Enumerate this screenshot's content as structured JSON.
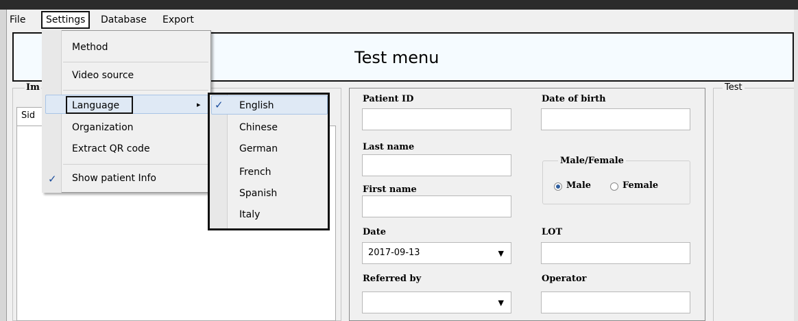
{
  "menubar": {
    "file": "File",
    "settings": "Settings",
    "database": "Database",
    "export": "Export"
  },
  "title": "Test menu",
  "left_group": {
    "title_fragment": "Im",
    "tab_fragment": "Sid"
  },
  "settings_menu": {
    "items": [
      "Method",
      "Video source",
      "Language",
      "Organization",
      "Extract QR code",
      "Show patient Info"
    ],
    "checked_item": "Show patient Info",
    "check_mark": "✓",
    "submenu_arrow": "▸"
  },
  "language_menu": {
    "items": [
      "English",
      "Chinese",
      "German",
      "French",
      "Spanish",
      "Italy"
    ],
    "selected": "English",
    "check_mark": "✓"
  },
  "form": {
    "patient_id": {
      "label": "Patient ID",
      "value": ""
    },
    "date_of_birth": {
      "label": "Date of birth",
      "value": ""
    },
    "last_name": {
      "label": "Last name",
      "value": ""
    },
    "first_name": {
      "label": "First name",
      "value": ""
    },
    "gender": {
      "title": "Male/Female",
      "male": "Male",
      "female": "Female",
      "selected": "Male"
    },
    "date": {
      "label": "Date",
      "value": "2017-09-13"
    },
    "lot": {
      "label": "LOT",
      "value": ""
    },
    "referred_by": {
      "label": "Referred by",
      "value": ""
    },
    "operator": {
      "label": "Operator",
      "value": ""
    },
    "dropdown_arrow": "▼"
  },
  "test_group": {
    "title": "Test"
  },
  "colors": {
    "highlight": "#dfe9f5",
    "highlight_border": "#a8c4e6",
    "check": "#1a4c9c",
    "banner": "#f5fbff",
    "radio_on": "#2f5e9e"
  }
}
